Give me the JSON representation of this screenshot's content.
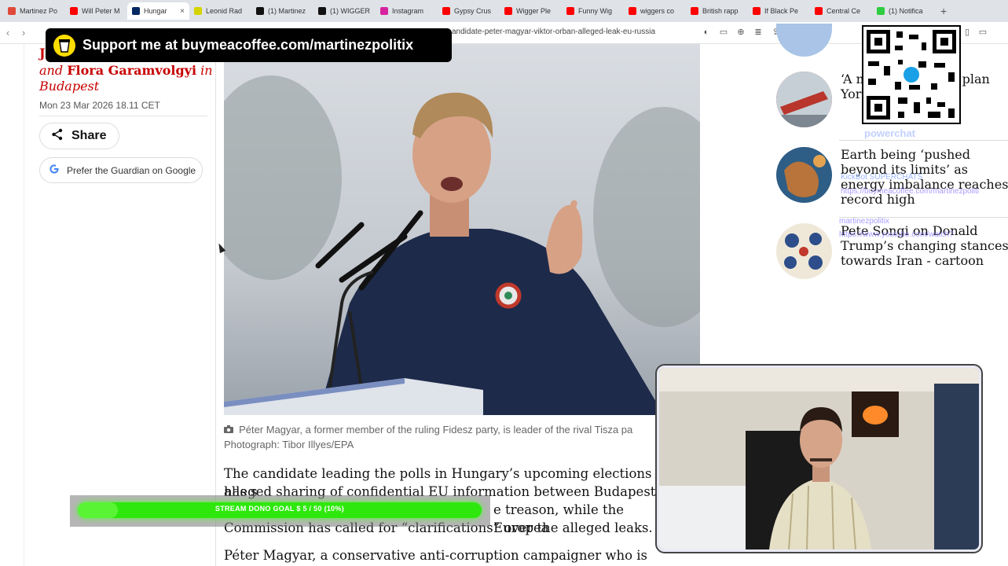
{
  "browser": {
    "tabs": [
      {
        "label": "Martinez Po",
        "color": "#e04a3a",
        "active": false
      },
      {
        "label": "Will Peter M",
        "color": "#ff0000",
        "active": false
      },
      {
        "label": "Hungar",
        "color": "#052962",
        "active": true
      },
      {
        "label": "Leonid Rad",
        "color": "#d4d400",
        "active": false
      },
      {
        "label": "(1) Martinez",
        "color": "#111111",
        "active": false
      },
      {
        "label": "(1) WIGGER",
        "color": "#111111",
        "active": false
      },
      {
        "label": "Instagram",
        "color": "#d6249f",
        "active": false
      },
      {
        "label": "Gypsy Crus",
        "color": "#ff0000",
        "active": false
      },
      {
        "label": "Wigger Ple",
        "color": "#ff0000",
        "active": false
      },
      {
        "label": "Funny Wig",
        "color": "#ff0000",
        "active": false
      },
      {
        "label": "wiggers co",
        "color": "#ff0000",
        "active": false
      },
      {
        "label": "British rapp",
        "color": "#ff0000",
        "active": false
      },
      {
        "label": "If Black Pe",
        "color": "#ff0000",
        "active": false
      },
      {
        "label": "Central Ce",
        "color": "#ff0000",
        "active": false
      },
      {
        "label": "(1) Notifica",
        "color": "#2ecc40",
        "active": false
      }
    ],
    "new_tab": "+",
    "close_tab": "×",
    "url": "andidate-peter-magyar-viktor-orban-alleged-leak-eu-russia"
  },
  "banner": {
    "text": "Support me at buymeacoffee.com/martinezpolitix"
  },
  "article": {
    "byline_top": "J",
    "byline_prefix": "and",
    "byline_name": "Flora Garamvolgyi",
    "byline_suffix": "in",
    "byline_place": "Budapest",
    "date": "Mon 23 Mar 2026 18.11 CET",
    "share_label": "Share",
    "google_label": "Prefer the Guardian on Google",
    "caption_line1": "Péter Magyar, a former member of the ruling Fidesz party, is leader of the rival Tisza pa",
    "caption_line2": "Photograph: Tibor Illyes/EPA",
    "para1_l1": "The candidate leading the polls in Hungary’s upcoming elections has s",
    "para1_l2": "alleged sharing of confidential EU information between Budapest and",
    "para1_l3": "e treason, while the Europea",
    "para1_l4": "Commission has called for “clarifications” over the alleged leaks.",
    "para2_l1": "Péter Magyar, a conservative anti-corruption campaigner who is mounting"
  },
  "rail": [
    {
      "title": "‘A m                flight atte             om plan               York crash",
      "thumb_color": "#a13b3b"
    },
    {
      "title": "Earth being ‘pushed beyond its limits’ as energy imbalance reaches record high",
      "thumb_color": "#3b6fa1"
    },
    {
      "title": "Pete Songi on Donald Trump’s changing stances towards Iran - cartoon",
      "thumb_color": "#e8e0cc"
    }
  ],
  "overlays": {
    "powerchat": "powerchat",
    "kick_line1": "KickBot   SUPERCHATS",
    "kick_line2": "https://buymeacoffee.com/martinezpoliti",
    "yt_line1": "martinezpolitix",
    "yt_line2": "https://www.youtube.com/watch?"
  },
  "goal": {
    "text": "STREAM DONO GOAL $ 5 / 50 (10%)",
    "progress": 0.1
  }
}
